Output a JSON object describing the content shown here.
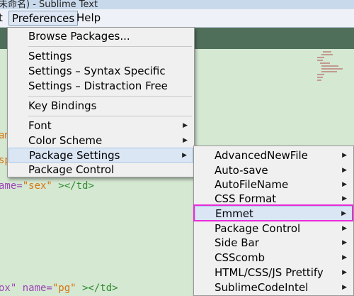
{
  "window": {
    "title": "未命名) - Sublime Text"
  },
  "menubar": {
    "partial": "t",
    "preferences": "Preferences",
    "help": "Help"
  },
  "editor": {
    "lines": [
      {
        "text": "am"
      },
      {
        "text": "sp"
      },
      {
        "part1": "ame=",
        "part2": "\"sex\"",
        "part3": " ></td>"
      },
      {
        "part1": "ox\" name=",
        "part2": "\"pg\"",
        "part3": " ></td>"
      }
    ]
  },
  "preferences_menu": {
    "items": [
      {
        "label": "Browse Packages..."
      },
      {
        "label": "Settings"
      },
      {
        "label": "Settings – Syntax Specific"
      },
      {
        "label": "Settings – Distraction Free"
      },
      {
        "label": "Key Bindings"
      },
      {
        "label": "Font"
      },
      {
        "label": "Color Scheme"
      },
      {
        "label": "Package Settings"
      },
      {
        "label": "Package Control"
      }
    ]
  },
  "package_settings_menu": {
    "items": [
      {
        "label": "AdvancedNewFile"
      },
      {
        "label": "Auto-save"
      },
      {
        "label": "AutoFileName"
      },
      {
        "label": "CSS Format"
      },
      {
        "label": "Emmet"
      },
      {
        "label": "Package Control"
      },
      {
        "label": "Side Bar"
      },
      {
        "label": "CSScomb"
      },
      {
        "label": "HTML/CSS/JS Prettify"
      },
      {
        "label": "SublimeCodeIntel"
      }
    ]
  },
  "colors": {
    "highlight_border": "#ea2bd8",
    "menu_hover": "#dbe6f5",
    "editor_bg": "#d4e8d2"
  }
}
